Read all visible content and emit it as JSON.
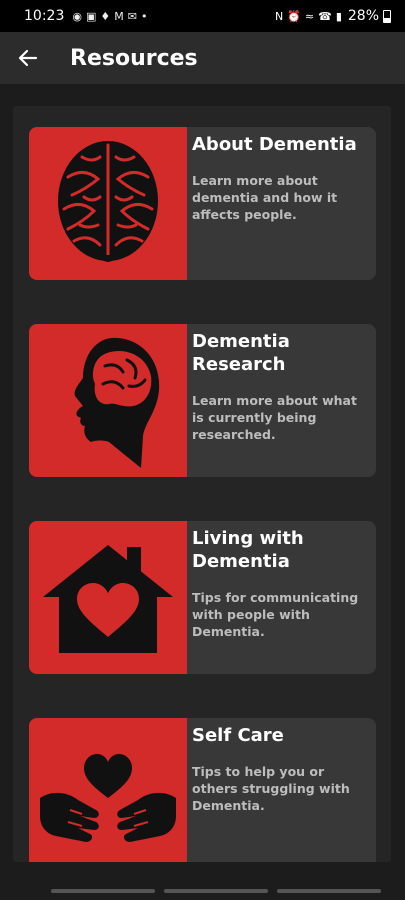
{
  "status": {
    "time": "10:23",
    "battery": "28%",
    "left_icons": [
      "messenger-icon",
      "instagram-icon",
      "snapchat-icon",
      "gmail-icon",
      "mail-icon",
      "dot-icon"
    ],
    "right_icons": [
      "nfc-icon",
      "alarm-icon",
      "wifi-icon",
      "call-icon",
      "signal-icon",
      "battery-icon"
    ]
  },
  "app_bar": {
    "title": "Resources",
    "back_icon": "arrow-left-icon"
  },
  "cards": [
    {
      "title": "About Dementia",
      "description": "Learn more about dementia and how it affects people.",
      "icon": "brain-icon"
    },
    {
      "title": "Dementia Research",
      "description": "Learn more about what is currently being researched.",
      "icon": "head-profile-brain-icon"
    },
    {
      "title": "Living with Dementia",
      "description": "Tips for communicating with people with Dementia.",
      "icon": "house-heart-icon"
    },
    {
      "title": "Self Care",
      "description": "Tips to help you or others struggling with Dementia.",
      "icon": "hands-heart-icon"
    }
  ],
  "colors": {
    "accent": "#d32a2a",
    "card_bg": "#383838",
    "app_bar_bg": "#2c2c2c",
    "page_bg": "#1c1c1c"
  }
}
